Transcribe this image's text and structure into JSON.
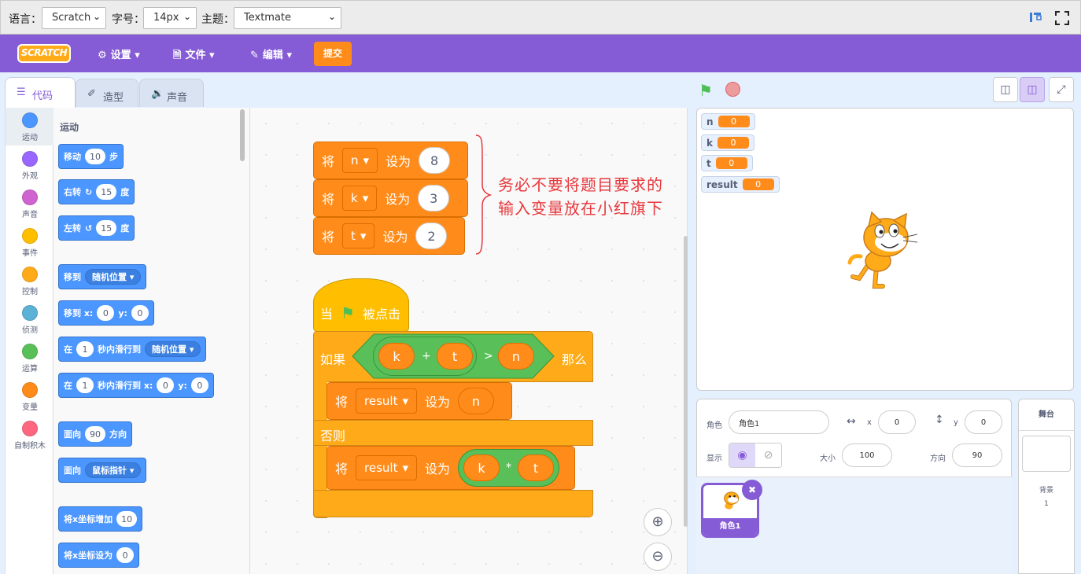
{
  "toolbar": {
    "lang_label": "语言：",
    "lang_value": "Scratch",
    "size_label": "字号：",
    "size_value": "14px",
    "theme_label": "主题：",
    "theme_value": "Textmate"
  },
  "menu": {
    "logo": "SCRATCH",
    "settings": "设置",
    "file": "文件",
    "edit": "编辑",
    "submit": "提交"
  },
  "tabs": {
    "code": "代码",
    "costume": "造型",
    "sound": "声音"
  },
  "categories": [
    {
      "label": "运动",
      "color": "#4c97ff"
    },
    {
      "label": "外观",
      "color": "#9966ff"
    },
    {
      "label": "声音",
      "color": "#cf63cf"
    },
    {
      "label": "事件",
      "color": "#ffbf00"
    },
    {
      "label": "控制",
      "color": "#ffab19"
    },
    {
      "label": "侦测",
      "color": "#5cb1d6"
    },
    {
      "label": "运算",
      "color": "#59c059"
    },
    {
      "label": "变量",
      "color": "#ff8c1a"
    },
    {
      "label": "自制积木",
      "color": "#ff6680"
    }
  ],
  "palette": {
    "title": "运动",
    "move": {
      "a": "移动",
      "v": "10",
      "b": "步"
    },
    "turn_right": {
      "a": "右转",
      "v": "15",
      "b": "度"
    },
    "turn_left": {
      "a": "左转",
      "v": "15",
      "b": "度"
    },
    "goto": {
      "a": "移到",
      "dd": "随机位置"
    },
    "goto_xy": {
      "a": "移到 x:",
      "x": "0",
      "b": "y:",
      "y": "0"
    },
    "glide": {
      "a": "在",
      "v": "1",
      "b": "秒内滑行到",
      "dd": "随机位置"
    },
    "glide_xy": {
      "a": "在",
      "v": "1",
      "b": "秒内滑行到 x:",
      "x": "0",
      "c": "y:",
      "y": "0"
    },
    "point_dir": {
      "a": "面向",
      "v": "90",
      "b": "方向"
    },
    "point_to": {
      "a": "面向",
      "dd": "鼠标指针"
    },
    "change_x": {
      "a": "将x坐标增加",
      "v": "10"
    },
    "set_x": {
      "a": "将x坐标设为",
      "v": "0"
    }
  },
  "script": {
    "set_word": "将",
    "to_word": "设为",
    "s1": {
      "var": "n",
      "val": "8"
    },
    "s2": {
      "var": "k",
      "val": "3"
    },
    "s3": {
      "var": "t",
      "val": "2"
    },
    "hat": {
      "a": "当",
      "b": "被点击"
    },
    "if_word": "如果",
    "then_word": "那么",
    "else_word": "否则",
    "cond": {
      "k": "k",
      "plus": "+",
      "t": "t",
      "gt": ">",
      "n": "n"
    },
    "set_a": {
      "var": "result",
      "val": "n"
    },
    "set_b": {
      "var": "result",
      "k": "k",
      "times": "*",
      "t": "t"
    }
  },
  "annotation": {
    "line1": "务必不要将题目要求的",
    "line2": "输入变量放在小红旗下"
  },
  "monitors": [
    {
      "name": "n",
      "value": "0"
    },
    {
      "name": "k",
      "value": "0"
    },
    {
      "name": "t",
      "value": "0"
    },
    {
      "name": "result",
      "value": "0"
    }
  ],
  "sprite_info": {
    "sprite_label": "角色",
    "sprite_name": "角色1",
    "x_label": "x",
    "x": "0",
    "y_label": "y",
    "y": "0",
    "show_label": "显示",
    "size_label": "大小",
    "size": "100",
    "dir_label": "方向",
    "dir": "90"
  },
  "sprite_thumb": {
    "name": "角色1"
  },
  "stage_panel": {
    "title": "舞台",
    "backdrop_label": "背景",
    "backdrop_count": "1"
  }
}
